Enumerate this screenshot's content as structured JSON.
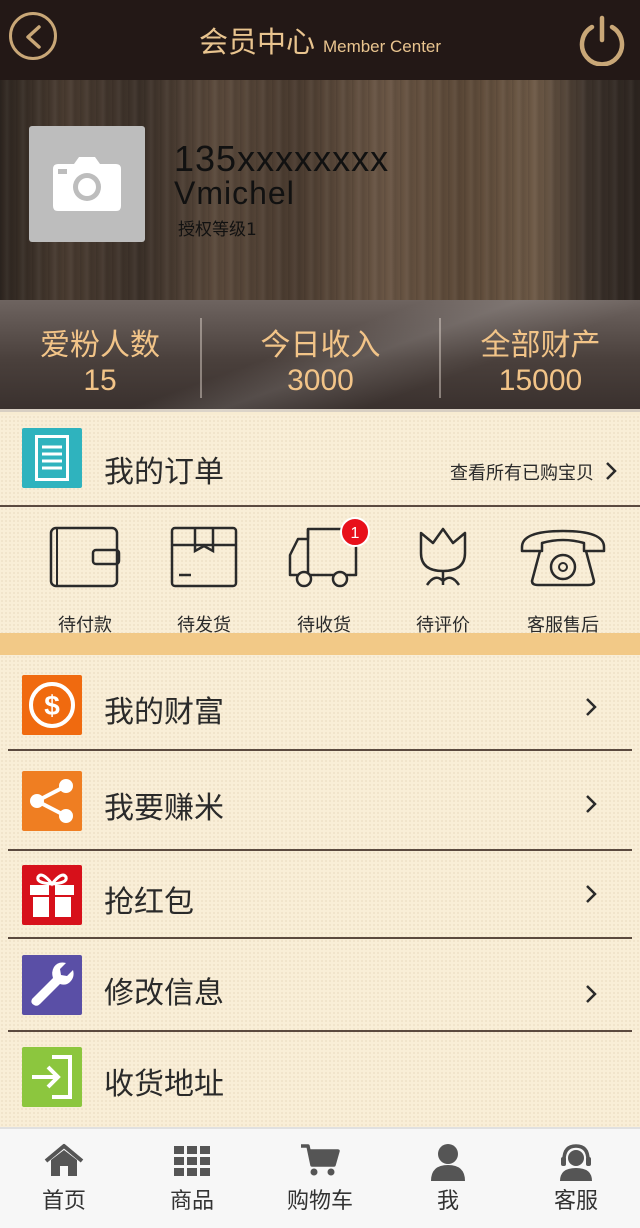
{
  "header": {
    "title": "会员中心",
    "subtitle": "Member Center"
  },
  "profile": {
    "phone": "135xxxxxxxx",
    "name": "Vmichel",
    "level": "授权等级1"
  },
  "stats": [
    {
      "label": "爱粉人数",
      "value": "15"
    },
    {
      "label": "今日收入",
      "value": "3000"
    },
    {
      "label": "全部财产",
      "value": "15000"
    }
  ],
  "orders": {
    "title": "我的订单",
    "view_all": "查看所有已购宝贝",
    "items": [
      {
        "label": "待付款",
        "icon": "wallet-icon"
      },
      {
        "label": "待发货",
        "icon": "package-icon"
      },
      {
        "label": "待收货",
        "icon": "truck-icon",
        "badge": "1"
      },
      {
        "label": "待评价",
        "icon": "tulip-icon"
      },
      {
        "label": "客服售后",
        "icon": "telephone-icon"
      }
    ]
  },
  "menu": [
    {
      "label": "我的财富",
      "icon": "dollar-icon",
      "color": "#f06a0f"
    },
    {
      "label": "我要赚米",
      "icon": "share-icon",
      "color": "#ef7e22"
    },
    {
      "label": "抢红包",
      "icon": "gift-icon",
      "color": "#d7101a"
    },
    {
      "label": "修改信息",
      "icon": "wrench-icon",
      "color": "#5a4fa6"
    },
    {
      "label": "收货地址",
      "icon": "sign-in-icon",
      "color": "#8cc63e"
    }
  ],
  "nav": [
    {
      "label": "首页",
      "icon": "home-icon"
    },
    {
      "label": "商品",
      "icon": "grid-icon"
    },
    {
      "label": "购物车",
      "icon": "cart-icon"
    },
    {
      "label": "我",
      "icon": "user-icon"
    },
    {
      "label": "客服",
      "icon": "support-icon"
    }
  ],
  "colors": {
    "accent": "#e9c48f",
    "header_bg": "#231816",
    "stat_text": "#f2c488",
    "band": "#f2c987"
  }
}
